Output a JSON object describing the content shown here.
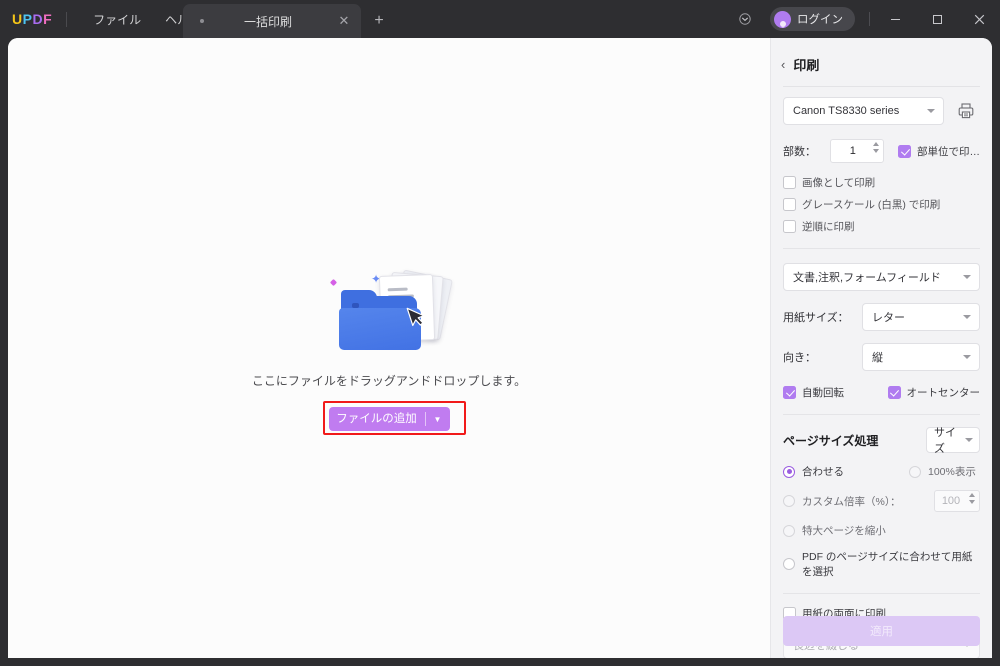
{
  "window": {
    "logo": {
      "l1": "U",
      "l2": "P",
      "l3": "D",
      "l4": "F"
    },
    "menu": [
      {
        "label": "ファイル"
      },
      {
        "label": "ヘルプ"
      }
    ],
    "tab": {
      "title": "一括印刷",
      "close": "✕",
      "new_tab": "+"
    },
    "account": {
      "login_label": "ログイン"
    },
    "controls": {
      "chevron": "⌄",
      "minimize": "—",
      "maximize": "▢",
      "close": "✕"
    }
  },
  "main": {
    "drop_text": "ここにファイルをドラッグアンドドロップします。",
    "add_button": {
      "label": "ファイルの追加",
      "arrow": "▼"
    }
  },
  "panel": {
    "back": "‹",
    "title": "印刷",
    "printer": {
      "value": "Canon TS8330 series"
    },
    "copies": {
      "label": "部数：",
      "value": "1"
    },
    "collate": {
      "label": "部単位で印…",
      "checked": true
    },
    "options": [
      {
        "label": "画像として印刷",
        "checked": false
      },
      {
        "label": "グレースケール (白黒) で印刷",
        "checked": false
      },
      {
        "label": "逆順に印刷",
        "checked": false
      }
    ],
    "content_select": {
      "value": "文書,注釈,フォームフィールド"
    },
    "paper_size": {
      "label": "用紙サイズ：",
      "value": "レター"
    },
    "orientation": {
      "label": "向き：",
      "value": "縦"
    },
    "auto_rotate": {
      "label": "自動回転",
      "checked": true
    },
    "auto_center": {
      "label": "オートセンター",
      "checked": true
    },
    "page_sizing": {
      "title": "ページサイズ処理",
      "mode": {
        "value": "サイズ"
      },
      "fit": {
        "label": "合わせる",
        "selected": true
      },
      "actual": {
        "label": "100%表示",
        "selected": false
      },
      "custom": {
        "label": "カスタム倍率（%）：",
        "value": "100",
        "selected": false
      },
      "shrink": {
        "label": "特大ページを縮小",
        "selected": false
      },
      "choose_source": {
        "label": "PDF のページサイズに合わせて用紙を選択",
        "selected": false
      }
    },
    "duplex": {
      "label": "用紙の両面に印刷",
      "checked": false
    },
    "binding": {
      "value": "長辺を綴じる"
    },
    "apply": {
      "label": "適用"
    }
  },
  "colors": {
    "accent_purple": "#b07cf0",
    "button_purple": "#c07cf0",
    "highlight_red": "#f11a1a",
    "folder_blue": "#3f6fe0",
    "titlebar_dark": "#2e2e31"
  }
}
